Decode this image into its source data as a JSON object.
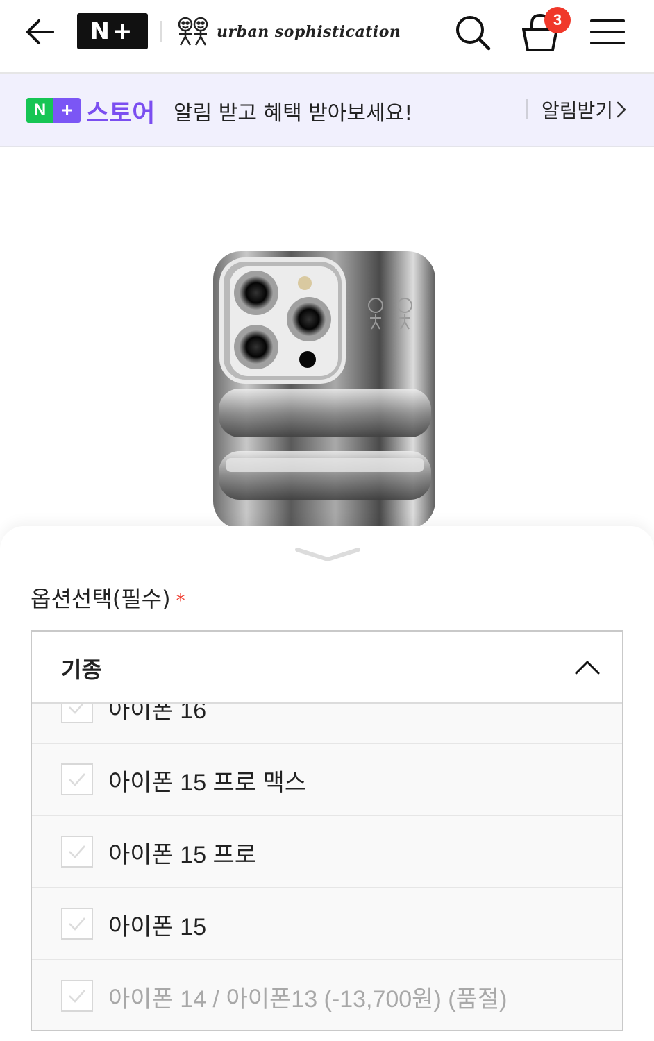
{
  "header": {
    "nplus_logo": "N+",
    "brand_name": "urban sophistication",
    "cart_count": "3"
  },
  "banner": {
    "badge_n": "N",
    "badge_plus": "+",
    "store_word": "스토어",
    "message": "알림 받고 혜택 받아보세요!",
    "alarm_link": "알림받기"
  },
  "options": {
    "title": "옵션선택(필수)",
    "required_mark": "*",
    "dropdown_label": "기종",
    "items": [
      {
        "label": "아이폰 16",
        "sold_out": false
      },
      {
        "label": "아이폰 15 프로 맥스",
        "sold_out": false
      },
      {
        "label": "아이폰 15 프로",
        "sold_out": false
      },
      {
        "label": "아이폰 15",
        "sold_out": false
      },
      {
        "label": "아이폰 14 / 아이폰13 (-13,700원) (품절)",
        "sold_out": true
      }
    ]
  },
  "colors": {
    "accent_purple": "#7b4ef0",
    "naver_green": "#16c554",
    "badge_red": "#f0382a",
    "banner_bg": "#f1f0fd"
  }
}
